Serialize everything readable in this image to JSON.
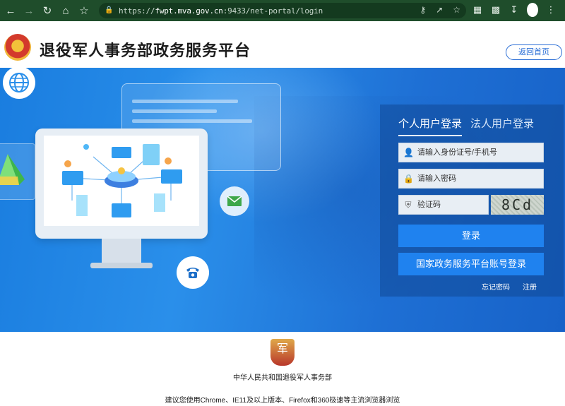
{
  "browser": {
    "url_host": "fwpt.mva.gov.cn",
    "url_rest": ":9433/net-portal/login",
    "url_prefix": "https://"
  },
  "header": {
    "title": "退役军人事务部政务服务平台",
    "home_button": "返回首页"
  },
  "login": {
    "tabs": [
      {
        "label": "个人用户登录",
        "active": true
      },
      {
        "label": "法人用户登录",
        "active": false
      }
    ],
    "id_placeholder": "请输入身份证号/手机号",
    "password_placeholder": "请输入密码",
    "captcha_placeholder": "验证码",
    "captcha_text": "8Cd",
    "login_button": "登录",
    "gov_login_button": "国家政务服务平台账号登录",
    "forgot_link": "忘记密码",
    "register_link": "注册"
  },
  "footer": {
    "logo_text": "军",
    "org": "中华人民共和国退役军人事务部",
    "browser_tip": "建议您使用Chrome、IE11及以上版本、Firefox和360极速等主流浏览器浏览"
  },
  "colors": {
    "accent": "#1f82ef",
    "chrome": "#1f4d2b"
  }
}
